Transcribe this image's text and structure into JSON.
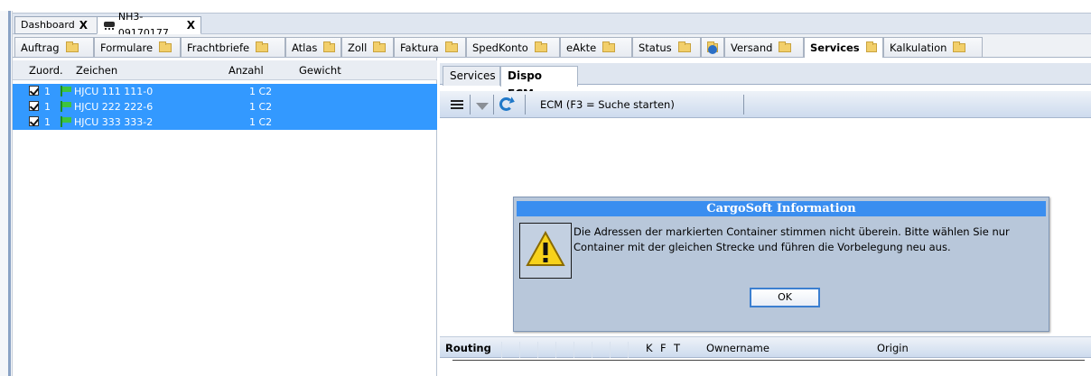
{
  "doc_tabs": [
    {
      "label": "Dashboard",
      "close": "X"
    },
    {
      "label": "NH3-09170177",
      "close": "X"
    }
  ],
  "module_tabs": [
    {
      "label": "Auftrag"
    },
    {
      "label": "Formulare"
    },
    {
      "label": "Frachtbriefe"
    },
    {
      "label": "Atlas"
    },
    {
      "label": "Zoll"
    },
    {
      "label": "Faktura"
    },
    {
      "label": "SpedKonto"
    },
    {
      "label": "eAkte"
    },
    {
      "label": "Status"
    },
    {
      "label": ""
    },
    {
      "label": "Versand"
    },
    {
      "label": "Services"
    },
    {
      "label": "Kalkulation"
    }
  ],
  "container_list": {
    "headers": {
      "zuord": "Zuord.",
      "zeichen": "Zeichen",
      "anzahl": "Anzahl",
      "gewicht": "Gewicht"
    },
    "rows": [
      {
        "zuord": "1",
        "zeichen": "HJCU 111 111-0",
        "anzahl": "1 C2"
      },
      {
        "zuord": "1",
        "zeichen": "HJCU 222 222-6",
        "anzahl": "1 C2"
      },
      {
        "zuord": "1",
        "zeichen": "HJCU 333 333-2",
        "anzahl": "1 C2"
      }
    ]
  },
  "right_tabs": [
    {
      "label": "Services"
    },
    {
      "label": "Dispo ECM"
    }
  ],
  "toolbar": {
    "search_hint": "ECM (F3 = Suche starten)"
  },
  "dialog": {
    "title": "CargoSoft Information",
    "message_line1": "Die Adressen der markierten Container stimmen nicht überein. Bitte wählen Sie nur",
    "message_line2": "Container mit der gleichen Strecke und führen die Vorbelegung neu aus.",
    "ok": "OK"
  },
  "routing": {
    "label": "Routing",
    "col_k": "K",
    "col_f": "F",
    "col_t": "T",
    "col_owner": "Ownername",
    "col_origin": "Origin"
  },
  "colors": {
    "selection": "#3399ff",
    "dialog_title": "#3a8ef0",
    "dialog_bg": "#b8c7da"
  }
}
